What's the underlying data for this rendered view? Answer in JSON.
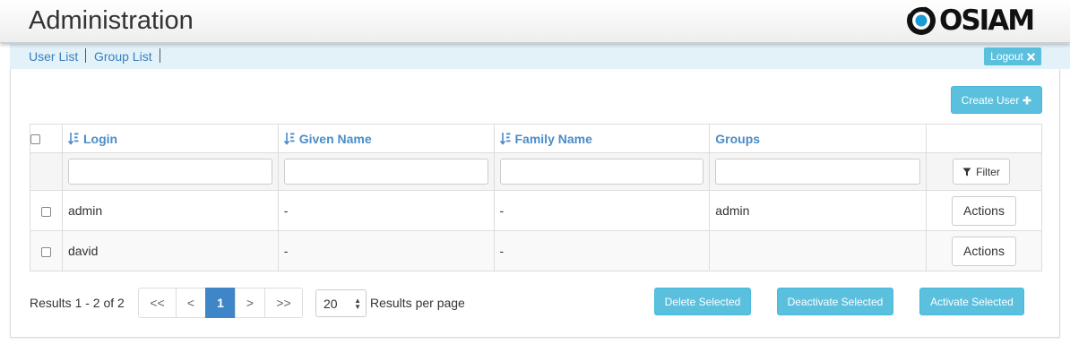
{
  "header": {
    "title": "Administration",
    "logo_text": "OSIAM"
  },
  "nav": {
    "user_list": "User List",
    "group_list": "Group List",
    "logout": "Logout"
  },
  "toolbar": {
    "create_user": "Create User"
  },
  "table": {
    "columns": {
      "login": "Login",
      "given_name": "Given Name",
      "family_name": "Family Name",
      "groups": "Groups"
    },
    "filter_label": "Filter",
    "rows": [
      {
        "login": "admin",
        "given_name": "-",
        "family_name": "-",
        "groups": "admin",
        "action": "Actions"
      },
      {
        "login": "david",
        "given_name": "-",
        "family_name": "-",
        "groups": "",
        "action": "Actions"
      }
    ]
  },
  "footer": {
    "results": "Results 1 - 2 of 2",
    "pages": {
      "first": "<<",
      "prev": "<",
      "current": "1",
      "next": ">",
      "last": ">>"
    },
    "per_page_value": "20",
    "per_page_label": "Results per page",
    "delete_selected": "Delete Selected",
    "deactivate_selected": "Deactivate Selected",
    "activate_selected": "Activate Selected"
  },
  "colors": {
    "accent": "#5bc0de",
    "link": "#3a80c0",
    "nav_bg": "#e3f1f9",
    "active_page": "#3f86c8"
  }
}
